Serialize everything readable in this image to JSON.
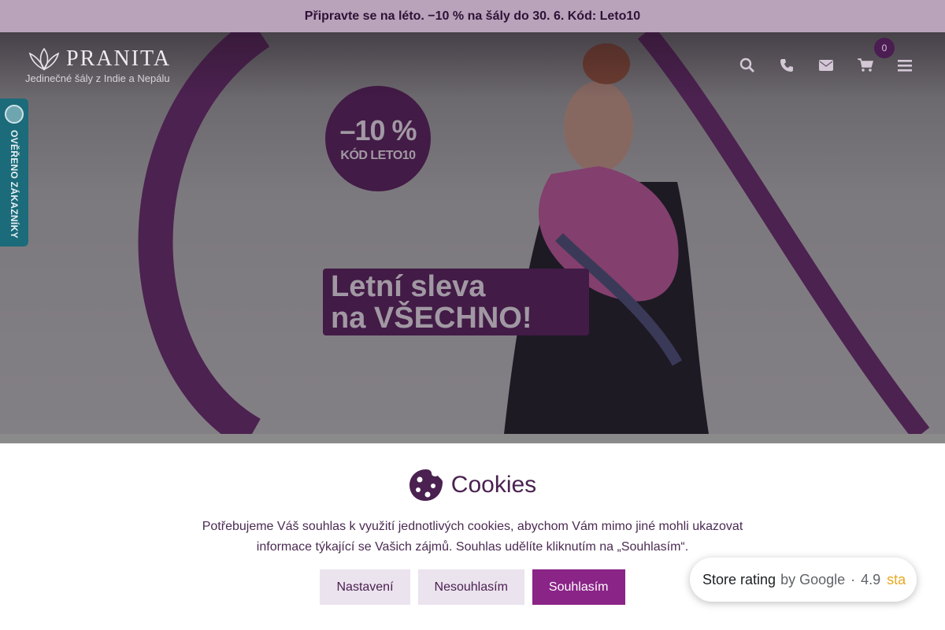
{
  "promo_bar": {
    "text": "Připravte se na léto. −10 % na šály do 30. 6. Kód: Leto10"
  },
  "header": {
    "logo_name": "PRANITA",
    "logo_tagline": "Jedinečné šály z Indie a Nepálu",
    "cart_count": "0",
    "icons": [
      "search-icon",
      "phone-icon",
      "envelope-icon",
      "cart-icon",
      "menu-icon"
    ]
  },
  "side_badge": {
    "text": "OVĚŘENO ZÁKAZNÍKY"
  },
  "hero": {
    "promo_pct": "–10 %",
    "promo_code": "KÓD LETO10",
    "banner_line1": "Letní sleva",
    "banner_line2": "na VŠECHNO!"
  },
  "cookies": {
    "title": "Cookies",
    "text": "Potřebujeme Váš souhlas k využití jednotlivých cookies, abychom Vám mimo jiné mohli ukazovat informace týkající se Vašich zájmů. Souhlas udělíte kliknutím na „Souhlasím“.",
    "settings_label": "Nastavení",
    "decline_label": "Nesouhlasím",
    "accept_label": "Souhlasím"
  },
  "store_rating": {
    "label": "Store rating",
    "by": "by Google",
    "separator": "·",
    "score": "4.9",
    "stars_text": "sta"
  },
  "colors": {
    "brand_purple": "#5a1f5c",
    "accent_button": "#8a2487",
    "promo_bar_bg": "#b9a3bb",
    "badge_teal": "#1b6b7a"
  }
}
